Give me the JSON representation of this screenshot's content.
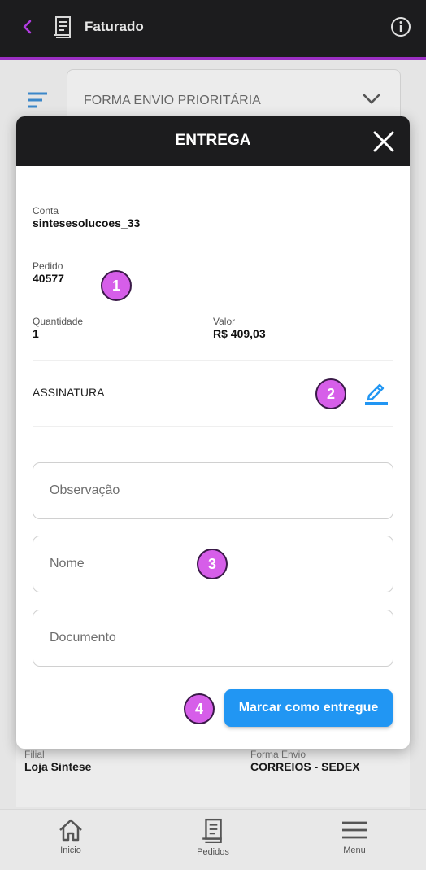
{
  "app_bar": {
    "title": "Faturado",
    "accent_color": "#9b2fc4",
    "back_icon": "chevron-left-icon",
    "page_icon": "receipt-icon",
    "info_icon": "info-icon"
  },
  "filter": {
    "icon": "filter-icon",
    "select_value": "FORMA ENVIO PRIORITÁRIA"
  },
  "background_card": {
    "filial_label": "Filial",
    "filial_value": "Loja Sintese",
    "forma_envio_label": "Forma Envio",
    "forma_envio_value": "CORREIOS - SEDEX"
  },
  "bottom_nav": [
    {
      "label": "Inicio",
      "icon": "home-icon"
    },
    {
      "label": "Pedidos",
      "icon": "receipt-icon"
    },
    {
      "label": "Menu",
      "icon": "menu-icon"
    }
  ],
  "modal": {
    "title": "ENTREGA",
    "conta_label": "Conta",
    "conta_value": "sintesesolucoes_33",
    "pedido_label": "Pedido",
    "pedido_value": "40577",
    "quantidade_label": "Quantidade",
    "quantidade_value": "1",
    "valor_label": "Valor",
    "valor_value": "R$ 409,03",
    "assinatura_label": "ASSINATURA",
    "observacao_placeholder": "Observação",
    "nome_placeholder": "Nome",
    "documento_placeholder": "Documento",
    "submit_label": "Marcar como entregue",
    "primary_color": "#2196f3"
  },
  "markers": [
    "1",
    "2",
    "3",
    "4"
  ]
}
